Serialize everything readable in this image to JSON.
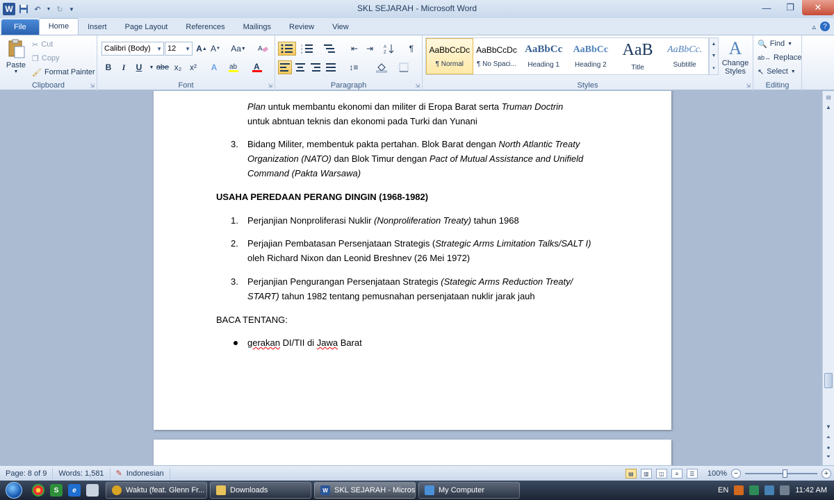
{
  "window": {
    "title": "SKL SEJARAH  -  Microsoft Word"
  },
  "ribbon_tabs": [
    "File",
    "Home",
    "Insert",
    "Page Layout",
    "References",
    "Mailings",
    "Review",
    "View"
  ],
  "clipboard": {
    "paste": "Paste",
    "cut": "Cut",
    "copy": "Copy",
    "format_painter": "Format Painter",
    "label": "Clipboard"
  },
  "font": {
    "family": "Calibri (Body)",
    "size": "12",
    "change_case": "Aa",
    "bold": "B",
    "italic": "I",
    "underline": "U",
    "strike": "abe",
    "subscript": "x₂",
    "superscript": "x²",
    "color_letter": "A",
    "label": "Font"
  },
  "paragraph": {
    "label": "Paragraph",
    "pilcrow": "¶"
  },
  "styles": {
    "items": [
      {
        "preview": "AaBbCcDc",
        "name": "¶ Normal"
      },
      {
        "preview": "AaBbCcDc",
        "name": "¶ No Spaci..."
      },
      {
        "preview": "AaBbCc",
        "name": "Heading 1"
      },
      {
        "preview": "AaBbCc",
        "name": "Heading 2"
      },
      {
        "preview": "AaB",
        "name": "Title"
      },
      {
        "preview": "AaBbCc.",
        "name": "Subtitle"
      }
    ],
    "change_styles": "Change Styles",
    "label": "Styles"
  },
  "editing": {
    "find": "Find",
    "replace": "Replace",
    "select": "Select",
    "label": "Editing"
  },
  "document": {
    "p1_line1_i": "Plan",
    "p1_line1_a": " untuk membantu ekonomi dan militer di Eropa Barat serta ",
    "p1_line1_i2": "Truman Doctrin",
    "p1_line2": "untuk abntuan teknis dan ekonomi pada Turki dan Yunani",
    "item3_num": "3.",
    "item3_a": "Bidang Militer, membentuk pakta pertahan. Blok Barat dengan ",
    "item3_i1": "North Atlantic Treaty",
    "item3_i2": "Organization (NATO)",
    "item3_b": " dan Blok Timur dengan ",
    "item3_i3": "Pact of Mutual Assistance and Unifield",
    "item3_i4": "Command (Pakta Warsawa)",
    "heading": "USAHA PEREDAAN PERANG DINGIN (1968-1982)",
    "list": [
      {
        "num": "1.",
        "a": "Perjanjian Nonproliferasi Nuklir ",
        "i": "(Nonproliferation Treaty)",
        "b": " tahun 1968"
      },
      {
        "num": "2.",
        "a": "Perjajian Pembatasan Persenjataan Strategis (",
        "i": "Strategic Arms Limitation Talks/SALT I)",
        "line2": "oleh Richard Nixon dan Leonid Breshnev (26 Mei 1972)"
      },
      {
        "num": "3.",
        "a": "Perjanjian Pengurangan Persenjataan Strategis ",
        "i": "(Stategic Arms Reduction Treaty/",
        "line2_i": "START)",
        "line2_b": " tahun 1982 tentang pemusnahan persenjataan nuklir jarak jauh"
      }
    ],
    "baca": "BACA TENTANG:",
    "bullet_a": "gerakan",
    "bullet_b": " DI/TII di ",
    "bullet_c": "Jawa",
    "bullet_d": " Barat"
  },
  "status": {
    "page": "Page: 8 of 9",
    "words": "Words: 1,581",
    "language": "Indonesian",
    "zoom": "100%"
  },
  "taskbar": {
    "tasks": [
      {
        "label": "Waktu (feat. Glenn Fr...",
        "color": "#d9a323"
      },
      {
        "label": "Downloads",
        "color": "#e8c25a"
      },
      {
        "label": "SKL SEJARAH - Micros...",
        "color": "#2b579a"
      },
      {
        "label": "My Computer",
        "color": "#4a90d9"
      }
    ],
    "lang": "EN",
    "time": "11:42 AM"
  }
}
